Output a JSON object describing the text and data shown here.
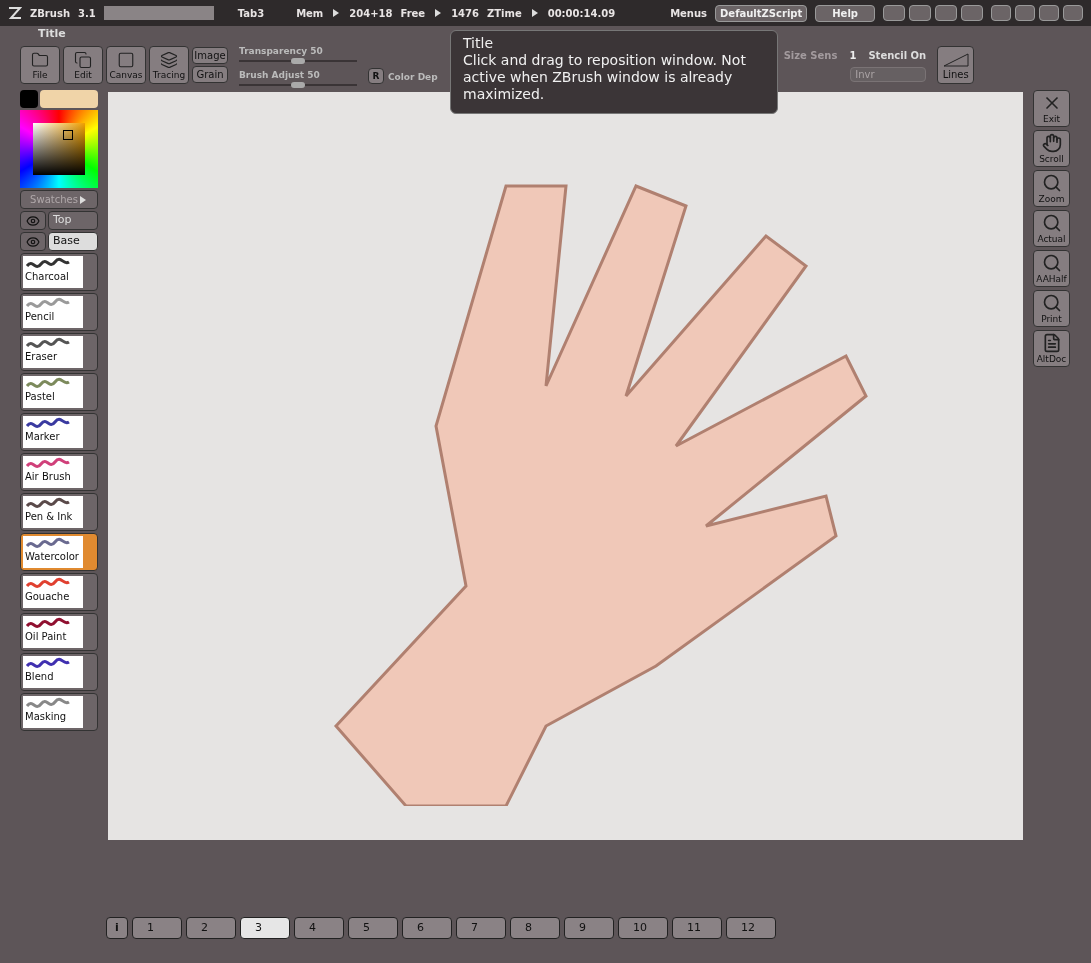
{
  "title_bar": {
    "app": "ZBrush",
    "version": "3.1",
    "document": "Tab3",
    "mem_label": "Mem",
    "mem": "204+18",
    "free_label": "Free",
    "free": "1476",
    "ztime_label": "ZTime",
    "ztime": "00:00:14.09",
    "menus_label": "Menus",
    "script": "DefaultZScript",
    "help": "Help"
  },
  "palette_title": "Title",
  "toolbar": {
    "buttons": [
      {
        "label": "File",
        "kind": "folder"
      },
      {
        "label": "Edit",
        "kind": "copy"
      },
      {
        "label": "Canvas",
        "kind": "square"
      },
      {
        "label": "Tracing",
        "kind": "layers"
      }
    ],
    "small_buttons": [
      "Image",
      "Grain"
    ],
    "sliders": [
      {
        "label": "Transparency",
        "value": "50",
        "level": 0.5
      },
      {
        "label": "Brush Adjust",
        "value": "50",
        "level": 0.5
      }
    ],
    "r_button": "R",
    "color_depth_label": "Color Dep",
    "size_sens": {
      "label": "Size Sens",
      "value": "1",
      "disabled": true
    },
    "stencil": "Stencil On",
    "invr": {
      "label": "Invr",
      "disabled": true
    },
    "lines": "Lines"
  },
  "tooltip": {
    "title": "Title",
    "text": "Click and drag to reposition window. Not active when ZBrush window is already maximized."
  },
  "swatches": "Swatches",
  "layers": [
    {
      "label": "Top",
      "selected": false
    },
    {
      "label": "Base",
      "selected": true
    }
  ],
  "brushes": [
    {
      "label": "Charcoal",
      "selected": false,
      "color": "#333333"
    },
    {
      "label": "Pencil",
      "selected": false,
      "color": "#9a9a9a"
    },
    {
      "label": "Eraser",
      "selected": false,
      "color": "#555555"
    },
    {
      "label": "Pastel",
      "selected": false,
      "color": "#7c8a5c"
    },
    {
      "label": "Marker",
      "selected": false,
      "color": "#3a3aa0"
    },
    {
      "label": "Air Brush",
      "selected": false,
      "color": "#d0407a"
    },
    {
      "label": "Pen & Ink",
      "selected": false,
      "color": "#5a4a4a"
    },
    {
      "label": "Watercolor",
      "selected": true,
      "color": "#6a6a90"
    },
    {
      "label": "Gouache",
      "selected": false,
      "color": "#e04030"
    },
    {
      "label": "Oil Paint",
      "selected": false,
      "color": "#901030"
    },
    {
      "label": "Blend",
      "selected": false,
      "color": "#4030b0"
    },
    {
      "label": "Masking",
      "selected": false,
      "color": "#888888"
    }
  ],
  "right_shelf": [
    {
      "label": "Exit",
      "kind": "close"
    },
    {
      "label": "Scroll",
      "kind": "hand"
    },
    {
      "label": "Zoom",
      "kind": "magnifier"
    },
    {
      "label": "Actual",
      "kind": "magnifier"
    },
    {
      "label": "AAHalf",
      "kind": "magnifier"
    },
    {
      "label": "Print",
      "kind": "magnifier"
    },
    {
      "label": "AltDoc",
      "kind": "document"
    }
  ],
  "tabs": {
    "info": "i",
    "items": [
      {
        "label": "1",
        "selected": false
      },
      {
        "label": "2",
        "selected": false
      },
      {
        "label": "3",
        "selected": true
      },
      {
        "label": "4",
        "selected": false
      },
      {
        "label": "5",
        "selected": false
      },
      {
        "label": "6",
        "selected": false
      },
      {
        "label": "7",
        "selected": false
      },
      {
        "label": "8",
        "selected": false
      },
      {
        "label": "9",
        "selected": false
      },
      {
        "label": "10",
        "selected": false
      },
      {
        "label": "11",
        "selected": false
      },
      {
        "label": "12",
        "selected": false
      }
    ]
  }
}
